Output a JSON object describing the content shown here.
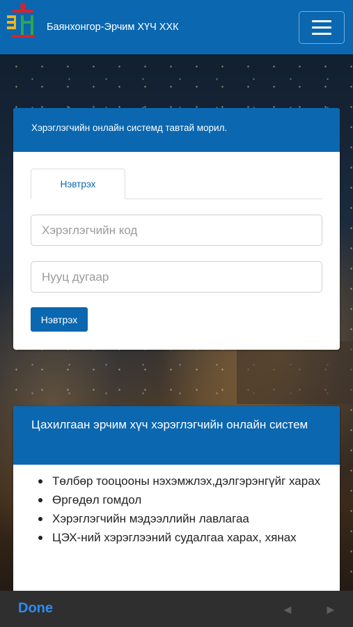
{
  "header": {
    "brand": "Баянхонгор-Эрчим ХҮЧ ХХК",
    "brand_color": "#0a67b0"
  },
  "login": {
    "welcome": "Хэрэглэгчийн онлайн системд тавтай морил.",
    "tab_label": "Нэвтрэх",
    "user_placeholder": "Хэрэглэгчийн код",
    "pass_placeholder": "Нууц дугаар",
    "submit_label": "Нэвтрэх"
  },
  "info": {
    "title": "Цахилгаан эрчим хүч хэрэглэгчийн онлайн систем",
    "items": [
      "Төлбөр тооцооны нэхэмжлэх,дэлгэрэнгүйг харах",
      "Өргөдөл гомдол",
      "Хэрэглэгчийн мэдээллийн лавлагаа",
      "ЦЭХ-ний хэрэглээний судалгаа харах, хянах"
    ]
  },
  "browser_bar": {
    "done_label": "Done",
    "back_icon": "◄",
    "forward_icon": "►"
  }
}
